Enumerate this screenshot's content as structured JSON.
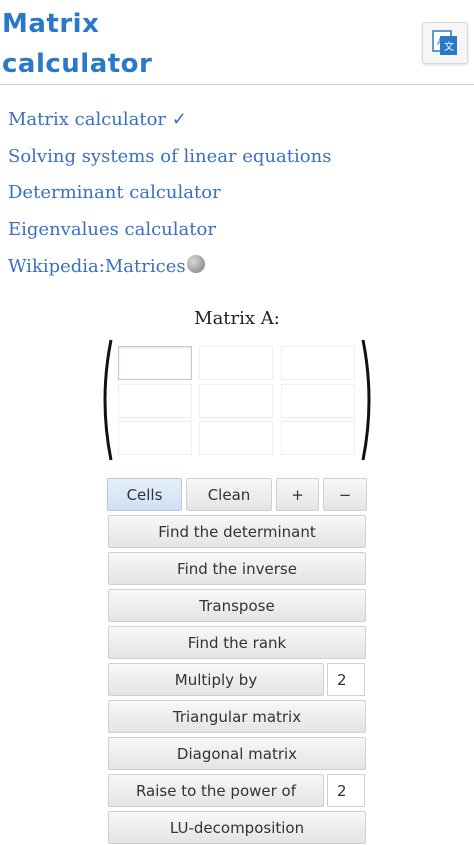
{
  "header": {
    "title_line1": "Matrix",
    "title_line2": "calculator",
    "translate_icon": "translate-icon"
  },
  "links": [
    "Matrix calculator ✓",
    "Solving systems of linear equations",
    "Determinant calculator",
    "Eigenvalues calculator",
    "Wikipedia:Matrices"
  ],
  "matrix": {
    "label": "Matrix A:"
  },
  "controls": {
    "cells": "Cells",
    "clean": "Clean",
    "plus": "+",
    "minus": "−"
  },
  "actions": {
    "determinant": "Find the determinant",
    "inverse": "Find the inverse",
    "transpose": "Transpose",
    "rank": "Find the rank",
    "multiply": "Multiply by",
    "multiply_value": "2",
    "triangular": "Triangular matrix",
    "diagonal": "Diagonal matrix",
    "power": "Raise to the power of",
    "power_value": "2",
    "lu": "LU-decomposition"
  }
}
